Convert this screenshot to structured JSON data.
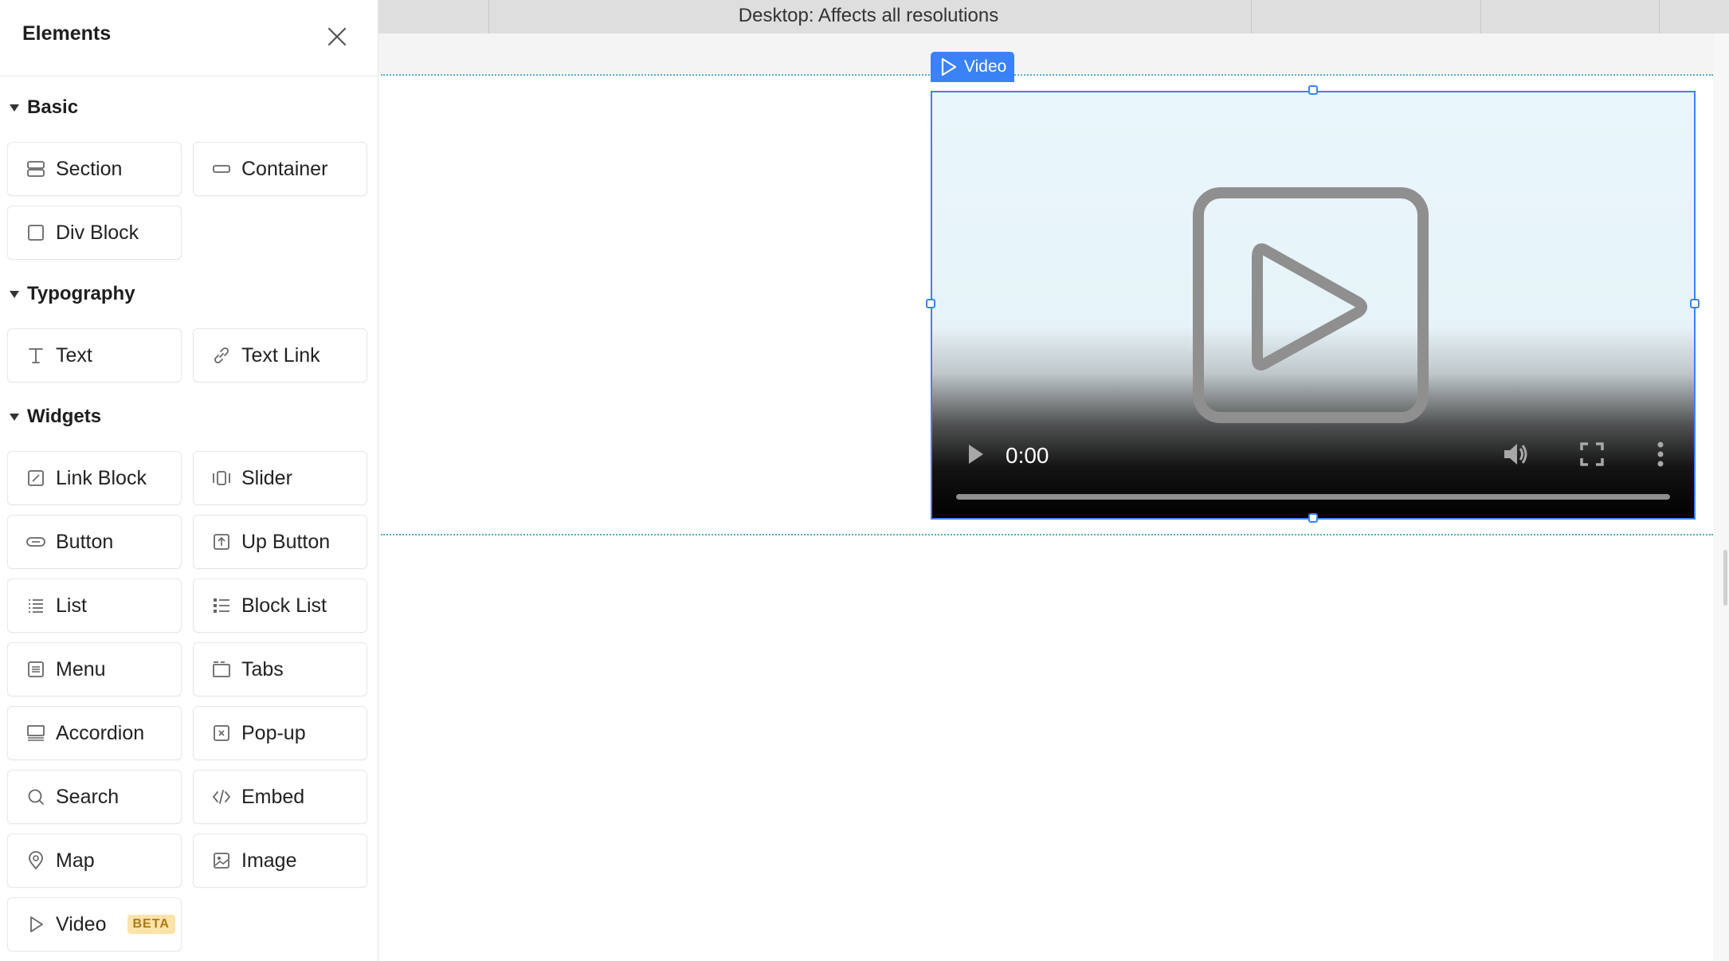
{
  "sidebar": {
    "title": "Elements",
    "sections": {
      "basic": {
        "heading": "Basic",
        "items": [
          "Section",
          "Container",
          "Div Block"
        ]
      },
      "typography": {
        "heading": "Typography",
        "items": [
          "Text",
          "Text Link"
        ]
      },
      "widgets": {
        "heading": "Widgets",
        "items": [
          "Link Block",
          "Slider",
          "Button",
          "Up Button",
          "List",
          "Block List",
          "Menu",
          "Tabs",
          "Accordion",
          "Pop-up",
          "Search",
          "Embed",
          "Map",
          "Image",
          "Video"
        ],
        "video_badge": "BETA"
      }
    }
  },
  "canvas": {
    "breakpoint_label": "Desktop: Affects all resolutions",
    "selected_element_tag": "Video",
    "video": {
      "time": "0:00"
    }
  },
  "colors": {
    "accent": "#3b82f6",
    "section_outline": "#53a9c9",
    "beta_bg": "#fbe3a9",
    "beta_text": "#b07a12"
  },
  "icons": {
    "close": "close-icon",
    "caret": "caret-down-icon",
    "section": "section-icon",
    "container": "container-icon",
    "div_block": "div-block-icon",
    "text": "text-icon",
    "text_link": "link-icon",
    "link_block": "link-block-icon",
    "slider": "slider-icon",
    "button": "button-icon",
    "up_button": "up-button-icon",
    "list": "list-icon",
    "block_list": "block-list-icon",
    "menu": "menu-icon",
    "tabs": "tabs-icon",
    "accordion": "accordion-icon",
    "popup": "popup-icon",
    "search": "search-icon",
    "embed": "embed-icon",
    "map": "map-pin-icon",
    "image": "image-icon",
    "video": "video-play-icon"
  }
}
